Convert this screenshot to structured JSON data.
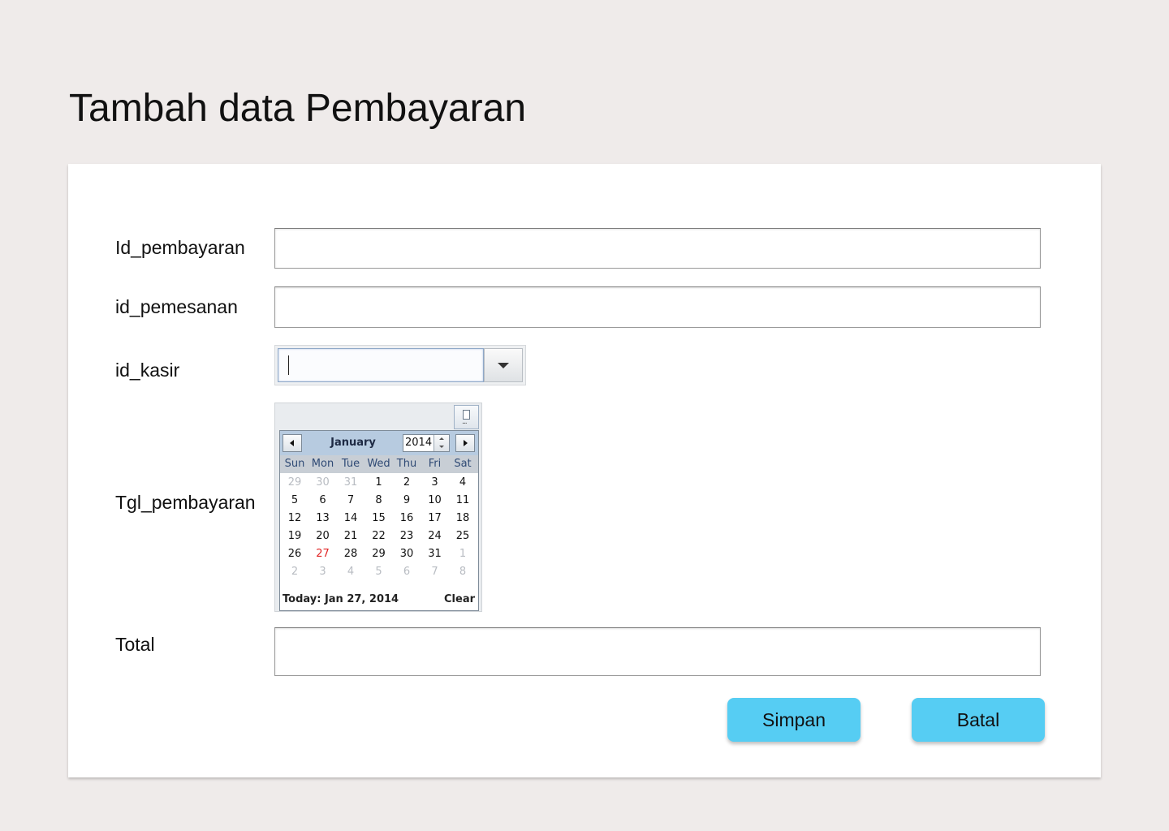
{
  "page_title": "Tambah data Pembayaran",
  "form": {
    "id_pembayaran_label": "Id_pembayaran",
    "id_pembayaran_value": "",
    "id_pemesanan_label": "id_pemesanan",
    "id_pemesanan_value": "",
    "id_kasir_label": "id_kasir",
    "id_kasir_value": "",
    "tgl_pembayaran_label": "Tgl_pembayaran",
    "total_label": "Total",
    "total_value": ""
  },
  "calendar": {
    "month": "January",
    "year": "2014",
    "weekdays": [
      "Sun",
      "Mon",
      "Tue",
      "Wed",
      "Thu",
      "Fri",
      "Sat"
    ],
    "weeks": [
      [
        "29",
        "30",
        "31",
        "1",
        "2",
        "3",
        "4"
      ],
      [
        "5",
        "6",
        "7",
        "8",
        "9",
        "10",
        "11"
      ],
      [
        "12",
        "13",
        "14",
        "15",
        "16",
        "17",
        "18"
      ],
      [
        "19",
        "20",
        "21",
        "22",
        "23",
        "24",
        "25"
      ],
      [
        "26",
        "27",
        "28",
        "29",
        "30",
        "31",
        "1"
      ],
      [
        "2",
        "3",
        "4",
        "5",
        "6",
        "7",
        "8"
      ]
    ],
    "today_day": "27",
    "today_text": "Today: Jan 27, 2014",
    "clear_label": "Clear",
    "today_color": "#e12626"
  },
  "buttons": {
    "save_label": "Simpan",
    "cancel_label": "Batal",
    "color": "#56cdf3"
  }
}
